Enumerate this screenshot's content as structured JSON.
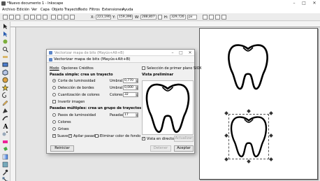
{
  "window": {
    "title": "*Nuevo documento 1 - Inkscape",
    "buttons": {
      "minimize": "–",
      "maximize": "□",
      "close": "✕"
    }
  },
  "menubar": [
    "Archivo",
    "Edición",
    "Ver",
    "Capa",
    "Objeto",
    "Trayecto",
    "Texto",
    "Filtros",
    "Extensiones",
    "Ayuda"
  ],
  "toolbar": {
    "x_label": "X:",
    "x_value": "223,190",
    "y_label": "Y:",
    "y_value": "159,396",
    "w_label": "W:",
    "w_value": "288,807",
    "h_label": "H:",
    "h_value": "329,726",
    "unit": "px"
  },
  "dialog": {
    "window_title": "Vectorizar mapa de bits (Mayús+Alt+B)",
    "panel_title": "Vectorizar mapa de bits (Mayús+Alt+B)",
    "tabs": [
      "Modo",
      "Opciones",
      "Créditos"
    ],
    "single_scan_heading": "Pasada simple: crea un trayecto",
    "single_options": [
      {
        "label": "Corte de luminosidad",
        "selected": true,
        "param": "Umbral:",
        "value": "0,770"
      },
      {
        "label": "Detección de bordes",
        "selected": false,
        "param": "Umbral:",
        "value": "0,000"
      },
      {
        "label": "Cuantización de colores",
        "selected": false,
        "param": "Colores:",
        "value": "32"
      }
    ],
    "invert_label": "Invertir imagen",
    "multi_scan_heading": "Pasadas múltiples: crea un grupo de trayectos",
    "multi_options": [
      {
        "label": "Pasos de luminosidad",
        "param": "Pasadas:",
        "value": "17"
      },
      {
        "label": "Colores"
      },
      {
        "label": "Grises"
      }
    ],
    "smooth_label": "Suave",
    "stack_label": "Apilar pasadas",
    "remove_bg_label": "Eliminar color de fondo",
    "sioox_label": "Selección de primer plano SIOX",
    "preview_heading": "Vista preliminar",
    "live_preview_label": "Vista en directo",
    "update_button": "Actualizar",
    "reset_button": "Reiniciar",
    "stop_button": "Detener",
    "ok_button": "Aceptar"
  },
  "icons": [
    "inkscape-app-icon",
    "selector-tool-icon",
    "node-tool-icon",
    "zoom-tool-icon",
    "rectangle-tool-icon",
    "ellipse-tool-icon",
    "star-tool-icon",
    "spiral-tool-icon",
    "pencil-tool-icon",
    "pen-tool-icon",
    "calligraphy-tool-icon",
    "text-tool-icon",
    "gradient-tool-icon",
    "dropper-tool-icon",
    "paint-bucket-tool-icon",
    "tooth-outline-icon"
  ],
  "colors": {
    "accent": "#3b6fb6",
    "canvas": "#e4e4e4",
    "page": "#ffffff"
  }
}
